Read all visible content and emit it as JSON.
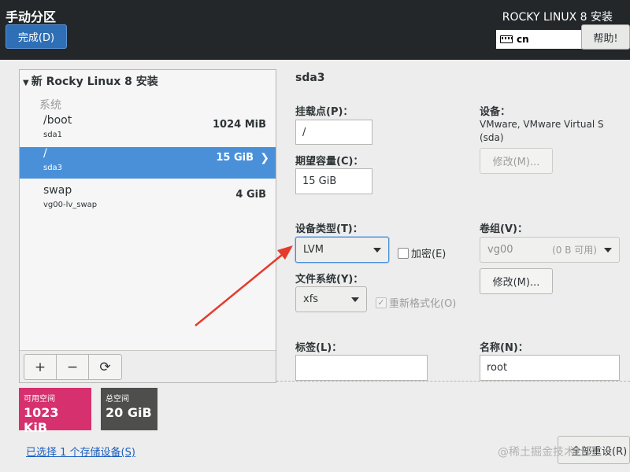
{
  "header": {
    "title": "手动分区",
    "done_label": "完成(D)",
    "product": "ROCKY LINUX 8 安装",
    "keyboard_layout": "cn",
    "help_label": "帮助!"
  },
  "tree": {
    "install_label": "新 Rocky Linux 8 安装",
    "system_label": "系统",
    "mounts": [
      {
        "name": "/boot",
        "device": "sda1",
        "size": "1024 MiB"
      },
      {
        "name": "/",
        "device": "sda3",
        "size": "15 GiB",
        "arrow": "❯"
      },
      {
        "name": "swap",
        "device": "vg00-lv_swap",
        "size": "4 GiB"
      }
    ]
  },
  "toolbar": {
    "add": "+",
    "remove": "−",
    "refresh": "⟳"
  },
  "space": {
    "available_label": "可用空间",
    "available_value": "1023 KiB",
    "total_label": "总空间",
    "total_value": "20 GiB"
  },
  "footer": {
    "storage_link": "已选择 1 个存储设备(S)",
    "reset_label": "全部重设(R)",
    "watermark": "@稀土掘金技术社区"
  },
  "detail": {
    "title": "sda3",
    "mount_point_label": "挂载点(P)：",
    "mount_point_value": "/",
    "capacity_label": "期望容量(C)：",
    "capacity_value": "15 GiB",
    "device_label": "设备：",
    "device_value": "VMware, VMware Virtual S (sda)",
    "modify_device_label": "修改(M)...",
    "device_type_label": "设备类型(T)：",
    "device_type_value": "LVM",
    "encrypt_label": "加密(E)",
    "volume_group_label": "卷组(V)：",
    "volume_group_value": "vg00",
    "volume_group_free": "(0 B 可用)",
    "modify_vg_label": "修改(M)...",
    "filesystem_label": "文件系统(Y)：",
    "filesystem_value": "xfs",
    "reformat_label": "重新格式化(O)",
    "reformat_check": "✓",
    "label_label": "标签(L)：",
    "label_value": "",
    "name_label": "名称(N)：",
    "name_value": "root"
  },
  "colors": {
    "header_bg": "#232729",
    "accent": "#4a90d9",
    "available_bg": "#d6306e",
    "total_bg": "#4e4e4c",
    "annotation_arrow": "#e53b2c"
  }
}
